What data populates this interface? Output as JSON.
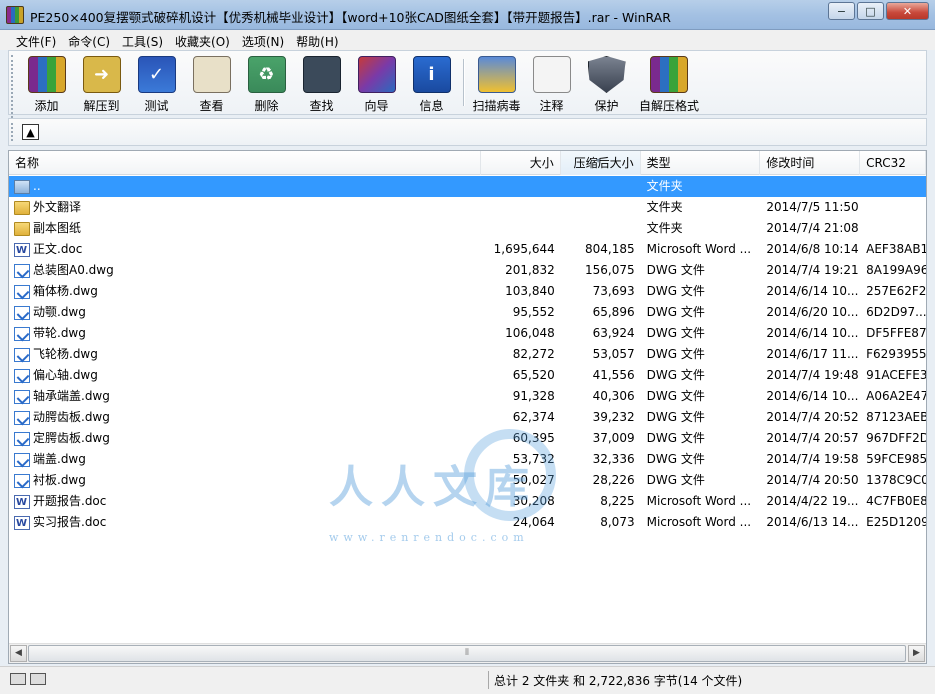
{
  "window": {
    "title": "PE250×400复摆颚式破碎机设计【优秀机械毕业设计】【word+10张CAD图纸全套】【带开题报告】.rar - WinRAR",
    "minimize": "−",
    "restore": "□",
    "close": "✕"
  },
  "menu": [
    "文件(F)",
    "命令(C)",
    "工具(S)",
    "收藏夹(O)",
    "选项(N)",
    "帮助(H)"
  ],
  "toolbar": {
    "add": "添加",
    "extract": "解压到",
    "test": "测试",
    "view": "查看",
    "delete": "删除",
    "find": "查找",
    "wizard": "向导",
    "info": "信息",
    "virus": "扫描病毒",
    "comment": "注释",
    "protect": "保护",
    "sfx": "自解压格式"
  },
  "columns": {
    "name": "名称",
    "size": "大小",
    "packed": "压缩后大小",
    "type": "类型",
    "modified": "修改时间",
    "crc": "CRC32"
  },
  "files": [
    {
      "name": "..",
      "size": "",
      "packed": "",
      "type": "文件夹",
      "modified": "",
      "crc": "",
      "icon": "parent-folder-icon",
      "selected": true
    },
    {
      "name": "外文翻译",
      "size": "",
      "packed": "",
      "type": "文件夹",
      "modified": "2014/7/5 11:50",
      "crc": "",
      "icon": "folder-icon"
    },
    {
      "name": "副本图纸",
      "size": "",
      "packed": "",
      "type": "文件夹",
      "modified": "2014/7/4 21:08",
      "crc": "",
      "icon": "folder-icon"
    },
    {
      "name": "正文.doc",
      "size": "1,695,644",
      "packed": "804,185",
      "type": "Microsoft Word ...",
      "modified": "2014/6/8 10:14",
      "crc": "AEF38AB1",
      "icon": "word-doc-icon"
    },
    {
      "name": "总装图A0.dwg",
      "size": "201,832",
      "packed": "156,075",
      "type": "DWG 文件",
      "modified": "2014/7/4 19:21",
      "crc": "8A199A96",
      "icon": "dwg-file-icon"
    },
    {
      "name": "箱体杨.dwg",
      "size": "103,840",
      "packed": "73,693",
      "type": "DWG 文件",
      "modified": "2014/6/14 10...",
      "crc": "257E62F2",
      "icon": "dwg-file-icon"
    },
    {
      "name": "动颚.dwg",
      "size": "95,552",
      "packed": "65,896",
      "type": "DWG 文件",
      "modified": "2014/6/20 10...",
      "crc": "6D2D97...",
      "icon": "dwg-file-icon"
    },
    {
      "name": "带轮.dwg",
      "size": "106,048",
      "packed": "63,924",
      "type": "DWG 文件",
      "modified": "2014/6/14 10...",
      "crc": "DF5FFE87",
      "icon": "dwg-file-icon"
    },
    {
      "name": "飞轮杨.dwg",
      "size": "82,272",
      "packed": "53,057",
      "type": "DWG 文件",
      "modified": "2014/6/17 11...",
      "crc": "F6293955",
      "icon": "dwg-file-icon"
    },
    {
      "name": "偏心轴.dwg",
      "size": "65,520",
      "packed": "41,556",
      "type": "DWG 文件",
      "modified": "2014/7/4 19:48",
      "crc": "91ACEFE3",
      "icon": "dwg-file-icon"
    },
    {
      "name": "轴承端盖.dwg",
      "size": "91,328",
      "packed": "40,306",
      "type": "DWG 文件",
      "modified": "2014/6/14 10...",
      "crc": "A06A2E47",
      "icon": "dwg-file-icon"
    },
    {
      "name": "动腭齿板.dwg",
      "size": "62,374",
      "packed": "39,232",
      "type": "DWG 文件",
      "modified": "2014/7/4 20:52",
      "crc": "87123AEB",
      "icon": "dwg-file-icon"
    },
    {
      "name": "定腭齿板.dwg",
      "size": "60,395",
      "packed": "37,009",
      "type": "DWG 文件",
      "modified": "2014/7/4 20:57",
      "crc": "967DFF2D",
      "icon": "dwg-file-icon"
    },
    {
      "name": "端盖.dwg",
      "size": "53,732",
      "packed": "32,336",
      "type": "DWG 文件",
      "modified": "2014/7/4 19:58",
      "crc": "59FCE985",
      "icon": "dwg-file-icon"
    },
    {
      "name": "衬板.dwg",
      "size": "50,027",
      "packed": "28,226",
      "type": "DWG 文件",
      "modified": "2014/7/4 20:50",
      "crc": "1378C9C0",
      "icon": "dwg-file-icon"
    },
    {
      "name": "开题报告.doc",
      "size": "30,208",
      "packed": "8,225",
      "type": "Microsoft Word ...",
      "modified": "2014/4/22 19...",
      "crc": "4C7FB0E8",
      "icon": "word-doc-icon"
    },
    {
      "name": "实习报告.doc",
      "size": "24,064",
      "packed": "8,073",
      "type": "Microsoft Word ...",
      "modified": "2014/6/13 14...",
      "crc": "E25D1209",
      "icon": "word-doc-icon"
    }
  ],
  "watermark": {
    "text": "人人文库",
    "url": "www.renrendoc.com"
  },
  "statusbar": {
    "summary": "总计 2 文件夹 和 2,722,836 字节(14 个文件)"
  }
}
